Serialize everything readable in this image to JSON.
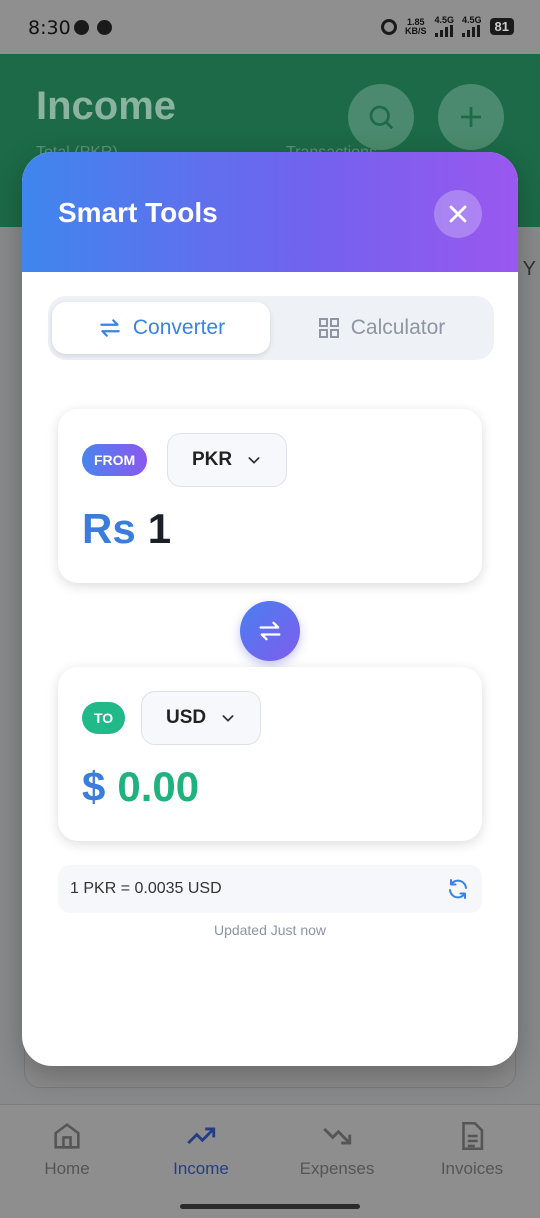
{
  "status_bar": {
    "time": "8:30",
    "net_speed_value": "1.85",
    "net_speed_unit": "KB/S",
    "sim1": "4.5G",
    "sim2": "4.5G",
    "battery": "81"
  },
  "app": {
    "title": "Income",
    "subtitle_left": "Total (PKR)",
    "subtitle_right": "Transactions",
    "side_fragment": "Y"
  },
  "bottom_nav": {
    "items": [
      {
        "label": "Home",
        "icon": "home-icon",
        "active": false
      },
      {
        "label": "Income",
        "icon": "trending-up-icon",
        "active": true
      },
      {
        "label": "Expenses",
        "icon": "trending-down-icon",
        "active": false
      },
      {
        "label": "Invoices",
        "icon": "document-icon",
        "active": false
      }
    ]
  },
  "modal": {
    "title": "Smart Tools",
    "tabs": [
      {
        "label": "Converter",
        "icon": "swap-arrows-icon",
        "active": true
      },
      {
        "label": "Calculator",
        "icon": "grid-icon",
        "active": false
      }
    ],
    "from": {
      "badge": "FROM",
      "currency": "PKR",
      "symbol": "Rs",
      "amount": "1"
    },
    "to": {
      "badge": "TO",
      "currency": "USD",
      "symbol": "$",
      "amount": "0.00"
    },
    "rate": "1 PKR = 0.0035 USD",
    "updated": "Updated Just now"
  },
  "colors": {
    "accent_blue": "#3b82e6",
    "accent_purple": "#8a58ee",
    "green": "#1fb27f",
    "header_green": "#1c6a47"
  }
}
